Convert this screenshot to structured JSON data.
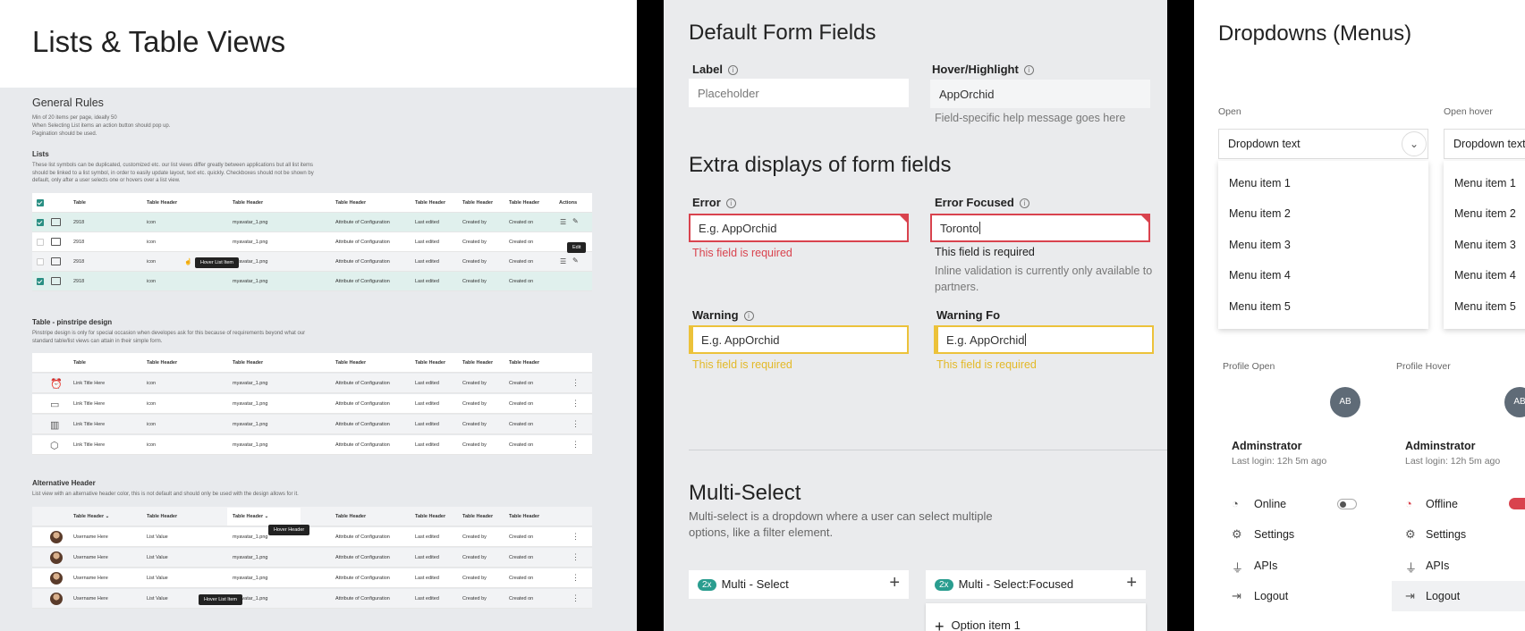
{
  "lists": {
    "title": "Lists & Table Views",
    "general_rules": {
      "heading": "General Rules",
      "lines": [
        "Min of 20 items per page, ideally 50",
        "When Selecting List items an action button should pop up.",
        "Pagination should be used."
      ]
    },
    "lists_section": {
      "heading": "Lists",
      "note": "These list symbols can be duplicated, customized etc. our list views differ greatly between applications but all list items should be linked to a list symbol, in order to easily update layout, text etc. quickly. Checkboxes should not be shown by default, only after a user selects one or hovers over a list view.",
      "headers": [
        "Table",
        "Table Header",
        "Table Header",
        "Table Header",
        "Table Header",
        "Table Header",
        "Table Header",
        "Actions"
      ],
      "rows": [
        [
          "2918",
          "icon",
          "myavatar_1.png",
          "Attribute of Configuration",
          "Last edited",
          "Created by",
          "Created on"
        ],
        [
          "2918",
          "icon",
          "myavatar_1.png",
          "Attribute of Configuration",
          "Last edited",
          "Created by",
          "Created on"
        ],
        [
          "2918",
          "icon",
          "myavatar_1.png",
          "Attribute of Configuration",
          "Last edited",
          "Created by",
          "Created on"
        ],
        [
          "2918",
          "icon",
          "myavatar_1.png",
          "Attribute of Configuration",
          "Last edited",
          "Created by",
          "Created on"
        ]
      ],
      "tooltip_hover": "Hover List Item",
      "tooltip_edit": "Edit"
    },
    "pinstripe": {
      "heading": "Table - pinstripe design",
      "note": "Pinstripe design is only for special occasion when developes ask for this because of requirements beyond what our standard table/list views can attain in their simple form.",
      "headers": [
        "Table",
        "Table Header",
        "Table Header",
        "Table Header",
        "Table Header",
        "Table Header",
        "Table Header"
      ],
      "rows": [
        [
          "Link Title Here",
          "icon",
          "myavatar_1.png",
          "Attribute of Configuration",
          "Last edited",
          "Created by",
          "Created on"
        ],
        [
          "Link Title Here",
          "icon",
          "myavatar_1.png",
          "Attribute of Configuration",
          "Last edited",
          "Created by",
          "Created on"
        ],
        [
          "Link Title Here",
          "icon",
          "myavatar_1.png",
          "Attribute of Configuration",
          "Last edited",
          "Created by",
          "Created on"
        ],
        [
          "Link Title Here",
          "icon",
          "myavatar_1.png",
          "Attribute of Configuration",
          "Last edited",
          "Created by",
          "Created on"
        ]
      ]
    },
    "alternative": {
      "heading": "Alternative Header",
      "note": "List view with an alternative header color, this is not default and should only be used with the design allows for it.",
      "headers": [
        "Table Header",
        "Table Header",
        "Table Header",
        "Table Header",
        "Table Header",
        "Table Header",
        "Table Header"
      ],
      "rows": [
        [
          "Username Here",
          "List Value",
          "myavatar_1.png",
          "Attribute of Configuration",
          "Last edited",
          "Created by",
          "Created on"
        ],
        [
          "Username Here",
          "List Value",
          "myavatar_1.png",
          "Attribute of Configuration",
          "Last edited",
          "Created by",
          "Created on"
        ],
        [
          "Username Here",
          "List Value",
          "myavatar_1.png",
          "Attribute of Configuration",
          "Last edited",
          "Created by",
          "Created on"
        ],
        [
          "Username Here",
          "List Value",
          "myavatar_1.png",
          "Attribute of Configuration",
          "Last edited",
          "Created by",
          "Created on"
        ]
      ],
      "tooltip_header": "Hover Header",
      "tooltip_item": "Hover List Item"
    }
  },
  "forms": {
    "default_title": "Default Form Fields",
    "label": {
      "label": "Label",
      "placeholder": "Placeholder"
    },
    "hover": {
      "label": "Hover/Highlight",
      "value": "AppOrchid",
      "help": "Field-specific help message goes here"
    },
    "extra_title": "Extra displays of form fields",
    "error": {
      "label": "Error",
      "value": "E.g. AppOrchid",
      "msg": "This field is required"
    },
    "error_focused": {
      "label": "Error Focused",
      "value": "Toronto",
      "msg": "This field is required",
      "help": "Inline validation is currently only available to partners."
    },
    "warning": {
      "label": "Warning",
      "value": "E.g. AppOrchid",
      "msg": "This field is required"
    },
    "warning_focused": {
      "label": "Warning Fo",
      "value": "E.g. AppOrchid",
      "msg": "This field is required"
    },
    "multi_title": "Multi-Select",
    "multi_desc": "Multi-select is a dropdown where a user can select multiple options, like a filter element.",
    "multi": {
      "badge": "2x",
      "label": "Multi - Select"
    },
    "multi_focused": {
      "badge": "2x",
      "label": "Multi - Select:Focused",
      "option": "Option item 1"
    }
  },
  "dropdowns": {
    "title": "Dropdowns (Menus)",
    "open_label": "Open",
    "open_hover_label": "Open hover",
    "dropdown_text": "Dropdown text",
    "items": [
      "Menu item 1",
      "Menu item 2",
      "Menu item 3",
      "Menu item 4",
      "Menu item 5"
    ],
    "profile_open_label": "Profile Open",
    "profile_hover_label": "Profile Hover",
    "initials": "AB",
    "name": "Adminstrator",
    "last_login": "Last login: 12h 5m ago",
    "online": "Online",
    "offline": "Offline",
    "settings": "Settings",
    "apis": "APIs",
    "logout": "Logout"
  },
  "colors": {
    "accent": "#2a8f83",
    "error": "#d9434e",
    "warning": "#ecc23a",
    "avatar": "#5f6b77"
  }
}
